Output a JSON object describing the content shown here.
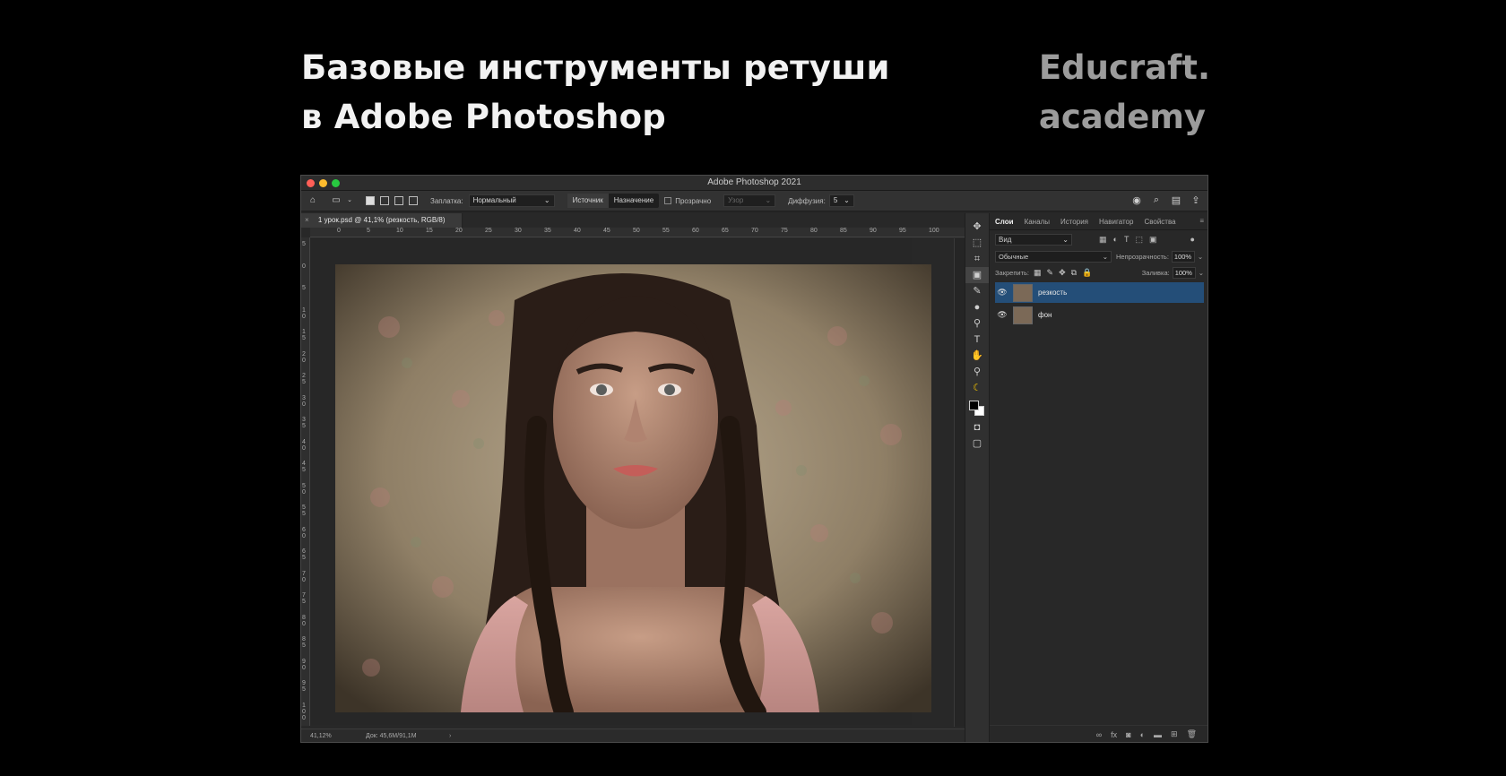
{
  "slide": {
    "title_line1": "Базовые инструменты ретуши",
    "title_line2": "в Adobe Photoshop",
    "brand_line1": "Educraft.",
    "brand_line2": "academy"
  },
  "window": {
    "title": "Adobe Photoshop 2021"
  },
  "options_bar": {
    "patch_label": "Заплатка:",
    "mode_value": "Нормальный",
    "source_label": "Источник",
    "destination_label": "Назначение",
    "transparent_label": "Прозрачно",
    "pattern_label": "Узор",
    "diffusion_label": "Диффузия:",
    "diffusion_value": "5"
  },
  "document": {
    "tab_title": "1 урок.psd @ 41,1% (резкость, RGB/8)",
    "ruler_h": [
      "0",
      "5",
      "10",
      "15",
      "20",
      "25",
      "30",
      "35",
      "40",
      "45",
      "50",
      "55",
      "60",
      "65",
      "70",
      "75",
      "80",
      "85",
      "90",
      "95",
      "100"
    ],
    "ruler_v": [
      "5",
      "0",
      "5",
      "1 0",
      "1 5",
      "2 0",
      "2 5",
      "3 0",
      "3 5",
      "4 0",
      "4 5",
      "5 0",
      "5 5",
      "6 0",
      "6 5",
      "7 0",
      "7 5",
      "8 0",
      "8 5",
      "9 0",
      "9 5",
      "1 0 0"
    ],
    "zoom": "41,12%",
    "doc_info": "Док: 45,6M/91,1M"
  },
  "layers_panel": {
    "tabs": [
      "Слои",
      "Каналы",
      "История",
      "Навигатор",
      "Свойства"
    ],
    "filter_kind": "Вид",
    "blend_mode": "Обычные",
    "opacity_label": "Непрозрачность:",
    "opacity_value": "100%",
    "lock_label": "Закрепить:",
    "fill_label": "Заливка:",
    "fill_value": "100%",
    "layers": [
      {
        "name": "резкость",
        "selected": true
      },
      {
        "name": "фон",
        "selected": false
      }
    ]
  },
  "colors": {
    "selected_layer": "#244e78",
    "foreground": "#000000",
    "background": "#ffffff"
  }
}
